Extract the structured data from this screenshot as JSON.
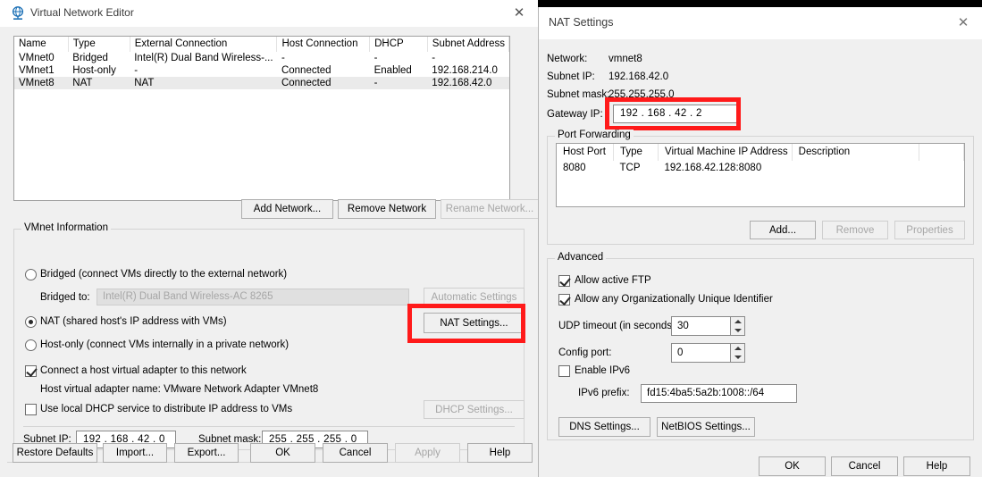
{
  "vne": {
    "title": "Virtual Network Editor",
    "title_icon": "network-globe-icon",
    "close_label": "✕",
    "table": {
      "headers": [
        "Name",
        "Type",
        "External Connection",
        "Host Connection",
        "DHCP",
        "Subnet Address"
      ],
      "rows": [
        {
          "name": "VMnet0",
          "type": "Bridged",
          "external": "Intel(R) Dual Band Wireless-...",
          "host": "-",
          "dhcp": "-",
          "subnet": "-",
          "selected": false
        },
        {
          "name": "VMnet1",
          "type": "Host-only",
          "external": "-",
          "host": "Connected",
          "dhcp": "Enabled",
          "subnet": "192.168.214.0",
          "selected": false
        },
        {
          "name": "VMnet8",
          "type": "NAT",
          "external": "NAT",
          "host": "Connected",
          "dhcp": "-",
          "subnet": "192.168.42.0",
          "selected": true
        }
      ]
    },
    "buttons": {
      "add_network": "Add Network...",
      "remove_network": "Remove Network",
      "rename_network": "Rename Network..."
    },
    "vmnet_info": {
      "group_label": "VMnet Information",
      "bridged_radio": "Bridged (connect VMs directly to the external network)",
      "bridged_to_label": "Bridged to:",
      "bridged_to_value": "Intel(R) Dual Band Wireless-AC 8265",
      "automatic_settings": "Automatic Settings",
      "nat_radio": "NAT (shared host's IP address with VMs)",
      "nat_settings_button": "NAT Settings...",
      "hostonly_radio": "Host-only (connect VMs internally in a private network)",
      "connect_host_adapter": "Connect a host virtual adapter to this network",
      "host_adapter_name": "Host virtual adapter name: VMware Network Adapter VMnet8",
      "use_local_dhcp": "Use local DHCP service to distribute IP address to VMs",
      "dhcp_settings_button": "DHCP Settings...",
      "subnet_ip_label": "Subnet IP:",
      "subnet_ip_value": "192 . 168 . 42 . 0",
      "subnet_mask_label": "Subnet mask:",
      "subnet_mask_value": "255 . 255 . 255 . 0",
      "selected_mode": "nat",
      "connect_host_adapter_checked": true,
      "use_local_dhcp_checked": false
    },
    "footer": {
      "restore_defaults": "Restore Defaults",
      "import": "Import...",
      "export": "Export...",
      "ok": "OK",
      "cancel": "Cancel",
      "apply": "Apply",
      "help": "Help"
    }
  },
  "nat": {
    "title": "NAT Settings",
    "close_label": "✕",
    "network_label": "Network:",
    "network_value": "vmnet8",
    "subnet_ip_label": "Subnet IP:",
    "subnet_ip_value": "192.168.42.0",
    "subnet_mask_label": "Subnet mask:",
    "subnet_mask_value": "255.255.255.0",
    "gateway_ip_label": "Gateway IP:",
    "gateway_ip_value": "192 . 168 . 42 .  2",
    "port_forwarding": {
      "group_label": "Port Forwarding",
      "headers": [
        "Host Port",
        "Type",
        "Virtual Machine IP Address",
        "Description"
      ],
      "rows": [
        {
          "host_port": "8080",
          "type": "TCP",
          "vm_ip": "192.168.42.128:8080",
          "description": ""
        }
      ],
      "add": "Add...",
      "remove": "Remove",
      "properties": "Properties"
    },
    "advanced": {
      "group_label": "Advanced",
      "allow_active_ftp": "Allow active FTP",
      "allow_active_ftp_checked": true,
      "allow_any_oui": "Allow any Organizationally Unique Identifier",
      "allow_any_oui_checked": true,
      "udp_timeout_label": "UDP timeout (in seconds):",
      "udp_timeout_value": "30",
      "config_port_label": "Config port:",
      "config_port_value": "0",
      "enable_ipv6": "Enable IPv6",
      "enable_ipv6_checked": false,
      "ipv6_prefix_label": "IPv6 prefix:",
      "ipv6_prefix_value": "fd15:4ba5:5a2b:1008::/64",
      "dns_settings": "DNS Settings...",
      "netbios_settings": "NetBIOS Settings..."
    },
    "footer": {
      "ok": "OK",
      "cancel": "Cancel",
      "help": "Help"
    }
  },
  "annotations": {
    "highlight_color": "#ff1a1a",
    "boxes": [
      "nat-settings-button-highlight",
      "gateway-ip-field-highlight"
    ]
  }
}
